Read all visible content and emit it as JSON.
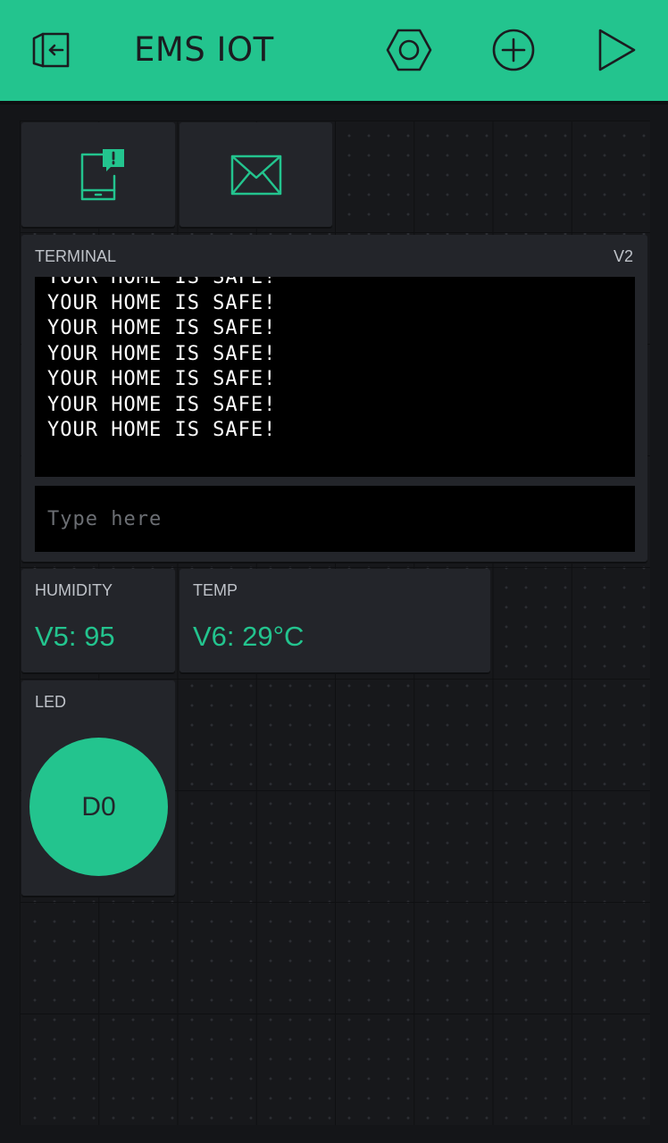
{
  "header": {
    "title": "EMS IOT",
    "bg_color": "#23c48e",
    "icons": [
      "exit-project-icon",
      "settings-nut-icon",
      "add-widget-icon",
      "play-icon"
    ]
  },
  "notify_widget": {
    "icon": "phone-notification-icon"
  },
  "email_widget": {
    "icon": "envelope-icon"
  },
  "terminal": {
    "label": "TERMINAL",
    "pin": "V2",
    "lines": [
      "YOUR HOME IS SAFE!",
      "YOUR HOME IS SAFE!",
      "YOUR HOME IS SAFE!",
      "YOUR HOME IS SAFE!",
      "YOUR HOME IS SAFE!",
      "YOUR HOME IS SAFE!",
      "YOUR HOME IS SAFE!"
    ],
    "input_placeholder": "Type here"
  },
  "humidity": {
    "label": "HUMIDITY",
    "value": "V5: 95"
  },
  "temp": {
    "label": "TEMP",
    "value": "V6: 29°C"
  },
  "led": {
    "label": "LED",
    "button_label": "D0"
  },
  "colors": {
    "accent": "#23c48e",
    "widget_bg": "#23252a",
    "canvas_bg": "#17181b"
  }
}
